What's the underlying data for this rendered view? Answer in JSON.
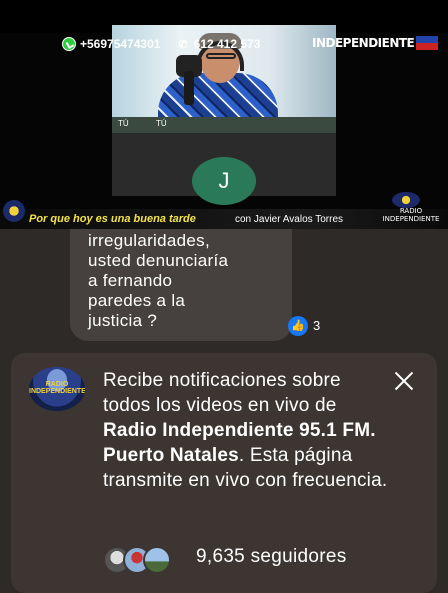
{
  "video": {
    "whatsapp": "+56975474301",
    "phone": "612 412 573",
    "brand": "INDEPENDIENTE",
    "feed_label_left": "TÚ",
    "feed_label_right": "TÚ",
    "participant_initial": "J",
    "lower_third_title": "Por que hoy es una buena tarde",
    "lower_third_subtitle": "con Javier Avalos Torres",
    "lower_third_brand": "RADIO INDEPENDIENTE"
  },
  "comment": {
    "text": "irregularidades,\nusted denunciaría\na fernando\nparedes a la\njusticia ?",
    "like_count": "3"
  },
  "notification": {
    "logo_text": "RADIO INDEPENDIENTE",
    "text_prefix": "Recibe notificaciones sobre todos los videos en vivo de ",
    "page_name": "Radio Independiente 95.1 FM. Puerto Natales",
    "text_suffix": ". Esta página transmite en vivo con frecuencia.",
    "followers": "9,635 seguidores"
  },
  "colors": {
    "accent_like": "#1877f2",
    "avatar_j": "#2a7a5a",
    "card_bg": "#3c3532",
    "lower_third_title": "#f2e24a"
  },
  "icons": [
    "whatsapp-icon",
    "phone-icon",
    "thumbs-up-icon",
    "close-icon"
  ]
}
